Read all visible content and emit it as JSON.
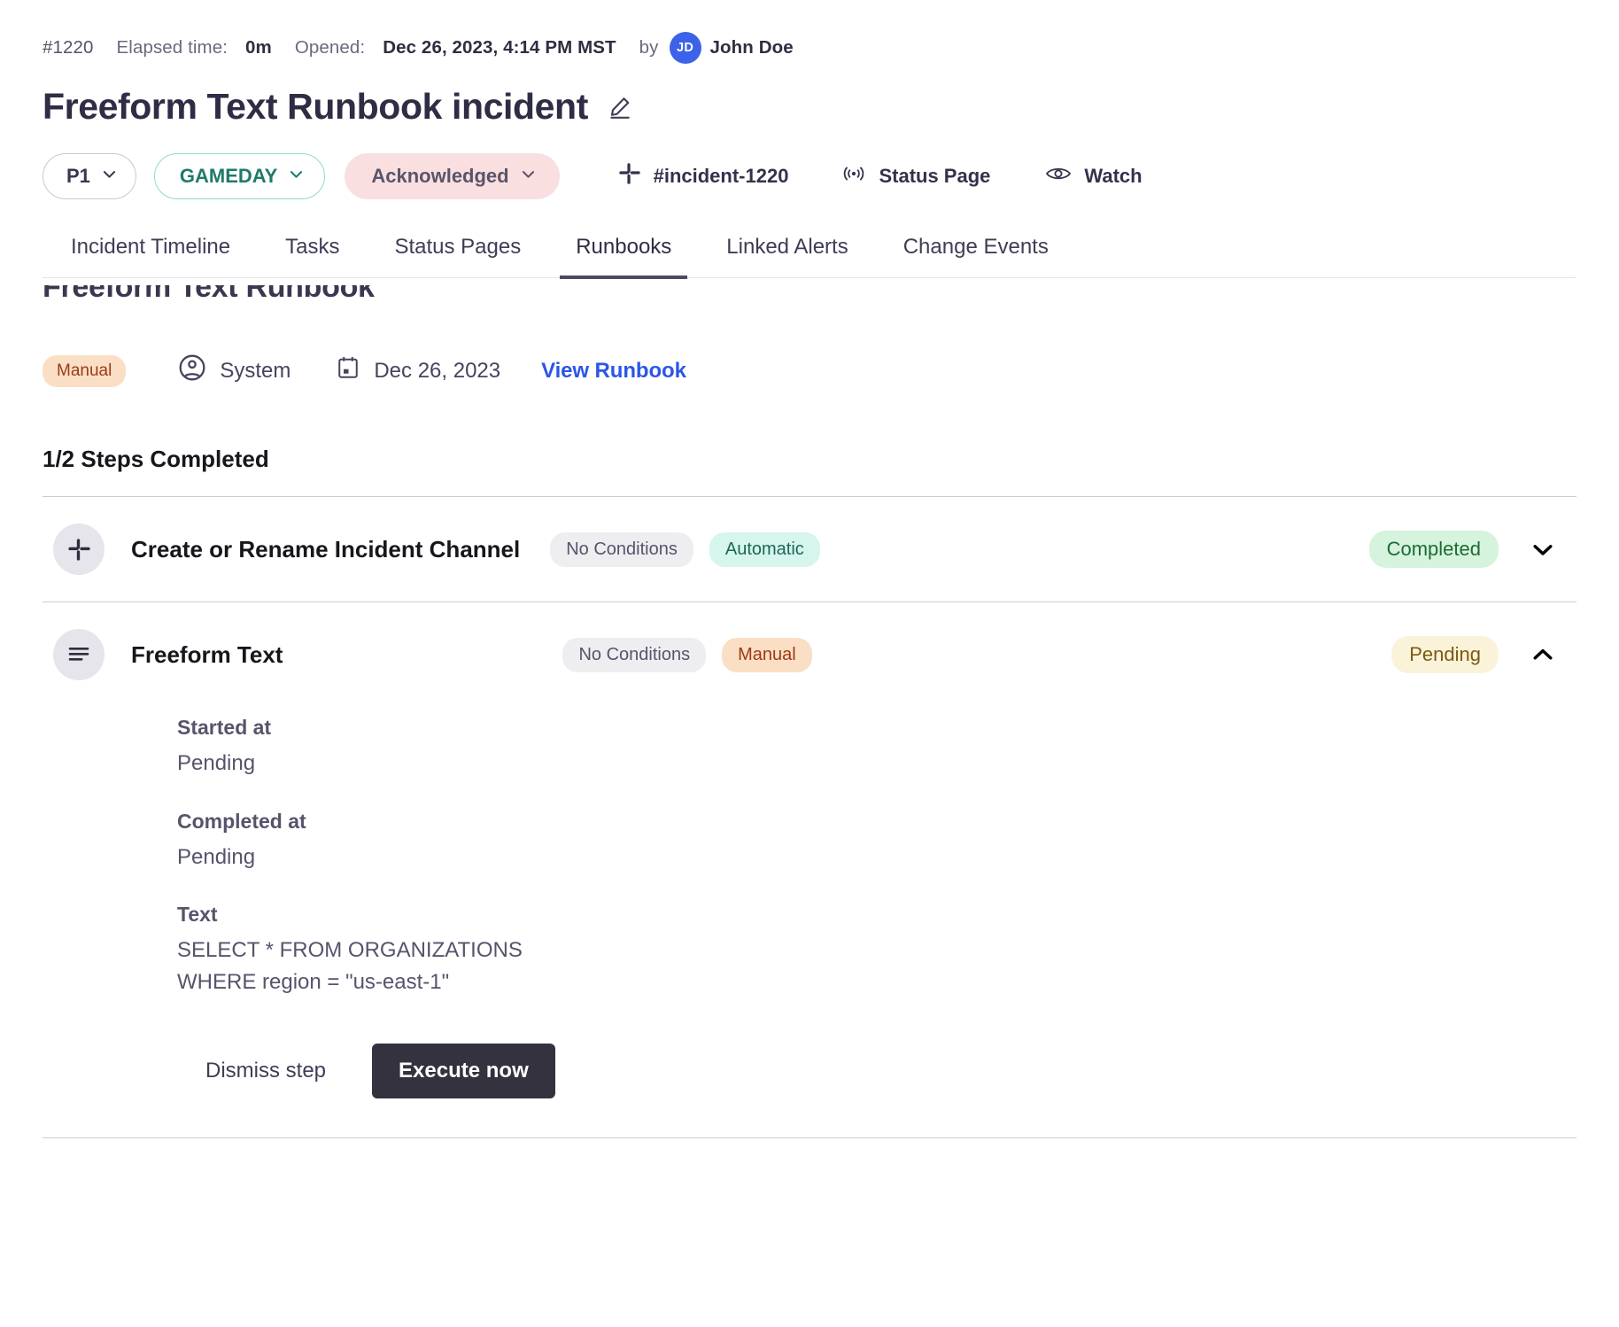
{
  "incident": {
    "id": "#1220",
    "elapsed_label": "Elapsed time:",
    "elapsed_value": "0m",
    "opened_label": "Opened:",
    "opened_value": "Dec 26, 2023, 4:14 PM MST",
    "by_label": "by",
    "owner_initials": "JD",
    "owner_name": "John Doe",
    "title": "Freeform Text Runbook incident",
    "edit_icon": "pencil-icon"
  },
  "badges": {
    "priority": "P1",
    "severity": "GAMEDAY",
    "status": "Acknowledged",
    "slack_channel": "#incident-1220",
    "status_page": "Status Page",
    "watch": "Watch"
  },
  "tabs": [
    {
      "label": "Incident Timeline",
      "active": false
    },
    {
      "label": "Tasks",
      "active": false
    },
    {
      "label": "Status Pages",
      "active": false
    },
    {
      "label": "Runbooks",
      "active": true
    },
    {
      "label": "Linked Alerts",
      "active": false
    },
    {
      "label": "Change Events",
      "active": false
    }
  ],
  "runbook": {
    "name": "Freeform Text Runbook",
    "type_pill": "Manual",
    "created_by": "System",
    "created_date": "Dec 26, 2023",
    "view_link": "View Runbook",
    "progress": "1/2 Steps Completed"
  },
  "steps": [
    {
      "icon": "slack-icon",
      "name": "Create or Rename Incident Channel",
      "conditions": "No Conditions",
      "execution": "Automatic",
      "status": "Completed",
      "expanded": false
    },
    {
      "icon": "text-lines-icon",
      "name": "Freeform Text",
      "conditions": "No Conditions",
      "execution": "Manual",
      "status": "Pending",
      "expanded": true,
      "details": {
        "started_at_label": "Started at",
        "started_at_value": "Pending",
        "completed_at_label": "Completed at",
        "completed_at_value": "Pending",
        "text_label": "Text",
        "text_value": "SELECT * FROM ORGANIZATIONS\nWHERE region = \"us-east-1\""
      },
      "actions": {
        "dismiss": "Dismiss step",
        "execute": "Execute now"
      }
    }
  ],
  "colors": {
    "accent_link": "#2c56e8",
    "avatar_bg": "#3b62e8",
    "status_completed_bg": "#d5f3dd",
    "status_pending_bg": "#fbf3d9",
    "ack_bg": "#f9dfe0",
    "gameday_border": "#8fd9cc",
    "primary_button_bg": "#34323f"
  }
}
